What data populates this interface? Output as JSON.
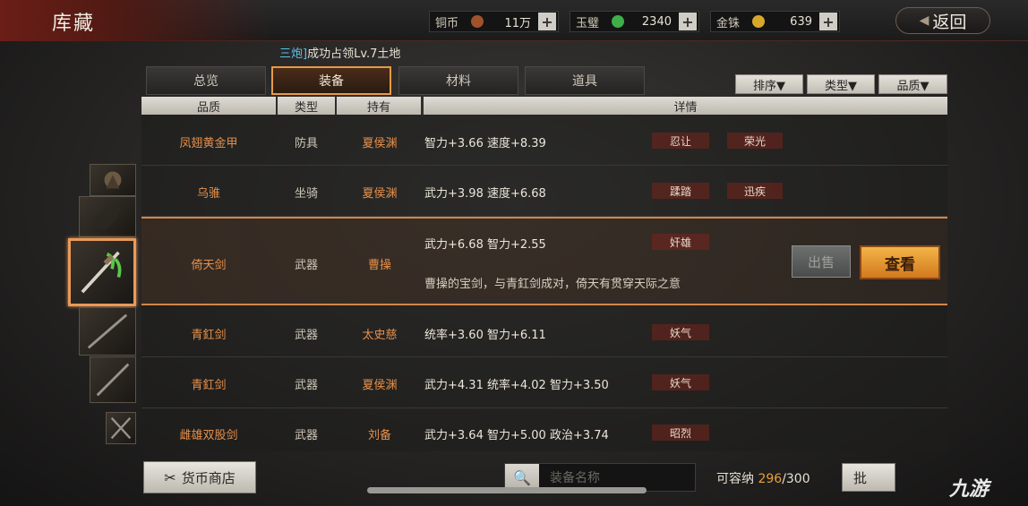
{
  "header": {
    "title": "库藏",
    "currencies": [
      {
        "label": "铜币",
        "amount": "11万",
        "coin_color": "#a0522d"
      },
      {
        "label": "玉璧",
        "amount": "2340",
        "coin_color": "#3fae4a"
      },
      {
        "label": "金铢",
        "amount": "639",
        "coin_color": "#d8a82a"
      }
    ],
    "plus": "+",
    "back_label": "返回"
  },
  "notice": {
    "highlight": "三炮]",
    "text": "成功占领Lv.7土地"
  },
  "tabs": [
    "总览",
    "装备",
    "材料",
    "道具"
  ],
  "active_tab": "装备",
  "filters": [
    "排序▼",
    "类型▼",
    "品质▼"
  ],
  "columns": [
    "品质",
    "类型",
    "持有",
    "详情"
  ],
  "rows": [
    {
      "name": "凤翅黄金甲",
      "type": "防具",
      "owner": "夏侯渊",
      "stats": "智力+3.66  速度+8.39",
      "tags": [
        "忍让",
        "荣光"
      ]
    },
    {
      "name": "乌骓",
      "type": "坐骑",
      "owner": "夏侯渊",
      "stats": "武力+3.98  速度+6.68",
      "tags": [
        "蹂踏",
        "迅疾"
      ]
    },
    {
      "name": "倚天剑",
      "type": "武器",
      "owner": "曹操",
      "stats": "武力+6.68  智力+2.55",
      "tags": [
        "奸雄"
      ],
      "desc": "曹操的宝剑，与青釭剑成对，倚天有贯穿天际之意"
    },
    {
      "name": "青釭剑",
      "type": "武器",
      "owner": "太史慈",
      "stats": "统率+3.60  智力+6.11",
      "tags": [
        "妖气"
      ]
    },
    {
      "name": "青釭剑",
      "type": "武器",
      "owner": "夏侯渊",
      "stats": "武力+4.31  统率+4.02  智力+3.50",
      "tags": [
        "妖气"
      ]
    },
    {
      "name": "雌雄双股剑",
      "type": "武器",
      "owner": "刘备",
      "stats": "武力+3.64  智力+5.00  政治+3.74",
      "tags": [
        "昭烈"
      ]
    }
  ],
  "actions": {
    "sell": "出售",
    "view": "查看"
  },
  "footer": {
    "shop_label": "货币商店",
    "search_placeholder": "装备名称",
    "capacity_label": "可容纳",
    "capacity_current": "296",
    "capacity_max": "/300",
    "bulk_label": "批"
  },
  "watermark": "九游"
}
